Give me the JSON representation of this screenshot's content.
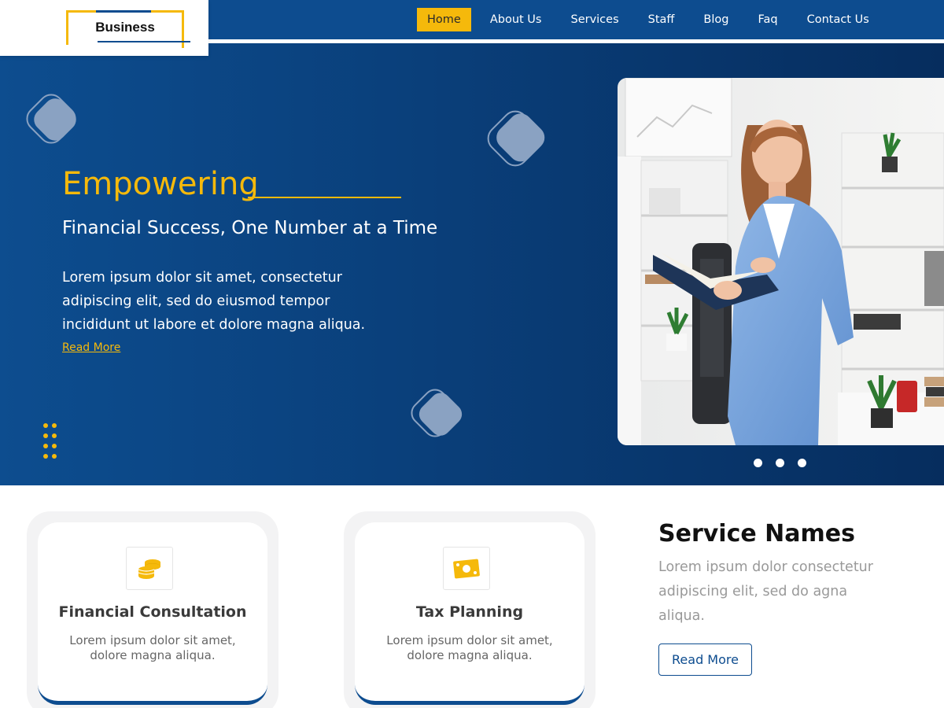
{
  "brand": {
    "logo_text": "Business"
  },
  "nav": {
    "items": [
      {
        "label": "Home",
        "active": true
      },
      {
        "label": "About Us"
      },
      {
        "label": "Services"
      },
      {
        "label": "Staff"
      },
      {
        "label": "Blog"
      },
      {
        "label": "Faq"
      },
      {
        "label": "Contact Us"
      }
    ]
  },
  "hero": {
    "title": "Empowering",
    "subtitle": "Financial Success, One Number at a Time",
    "text": "Lorem ipsum dolor sit amet, consectetur adipiscing elit, sed do eiusmod tempor incididunt ut labore et dolore magna aliqua.",
    "link_label": "Read More",
    "slide_count": 3
  },
  "cards": [
    {
      "icon": "coins-icon",
      "title": "Financial Consultation",
      "text": "Lorem ipsum dolor sit amet, dolore magna aliqua."
    },
    {
      "icon": "money-bill-icon",
      "title": "Tax Planning",
      "text": "Lorem ipsum dolor sit amet, dolore magna aliqua."
    }
  ],
  "services": {
    "title": "Service Names",
    "text": "Lorem ipsum dolor consectetur adipiscing elit, sed do agna aliqua.",
    "button_label": "Read More"
  },
  "colors": {
    "primary_blue": "#0d4c8f",
    "accent_yellow": "#f5b90b"
  }
}
